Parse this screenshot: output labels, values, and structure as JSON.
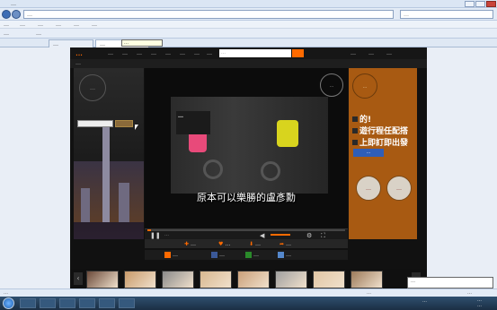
{
  "browser": {
    "title": "…",
    "url": "…",
    "search_placeholder": "…",
    "menu": [
      "…",
      "…",
      "…",
      "…",
      "…",
      "…"
    ],
    "favorites": [
      "…",
      "…"
    ],
    "tabs": [
      "…",
      "…"
    ],
    "tooltip": "…"
  },
  "site": {
    "logo": "…",
    "nav": [
      "…",
      "…",
      "…",
      "…",
      "…",
      "…",
      "…",
      "…"
    ],
    "search_placeholder": "…",
    "right_nav": [
      "…",
      "…",
      "…"
    ],
    "breadcrumb": "…"
  },
  "video": {
    "poster_text": "…",
    "subtitle": "原本可以樂勝的盧彥勳",
    "time": "…",
    "progress": 0.02,
    "volume": 0.6
  },
  "left_ad": {
    "logo": "…",
    "button": "…"
  },
  "right_ad": {
    "logo": "…",
    "lines": [
      "的!",
      "遊行程任配搭",
      "上即訂即出發"
    ],
    "button": "…",
    "badge1": "…",
    "badge2": "…"
  },
  "actions": [
    "…",
    "…",
    "…",
    "…"
  ],
  "share": [
    "…",
    "…",
    "…",
    "…"
  ],
  "thumbs": {
    "colors": [
      "#6b4a3a",
      "#c89a6a",
      "#8a8a8a",
      "#d8b890",
      "#caa07a",
      "#a0a0a0",
      "#e2c6a4",
      "#9c7a5a"
    ]
  },
  "statusbar": {
    "left": "…",
    "middle": "…",
    "zoom": "…"
  },
  "taskbar": {
    "ime": "…",
    "clock_time": "…",
    "clock_date": "…"
  },
  "notification": "…",
  "colors": {
    "accent": "#ff6a00",
    "right_ad": "#a85a12"
  }
}
